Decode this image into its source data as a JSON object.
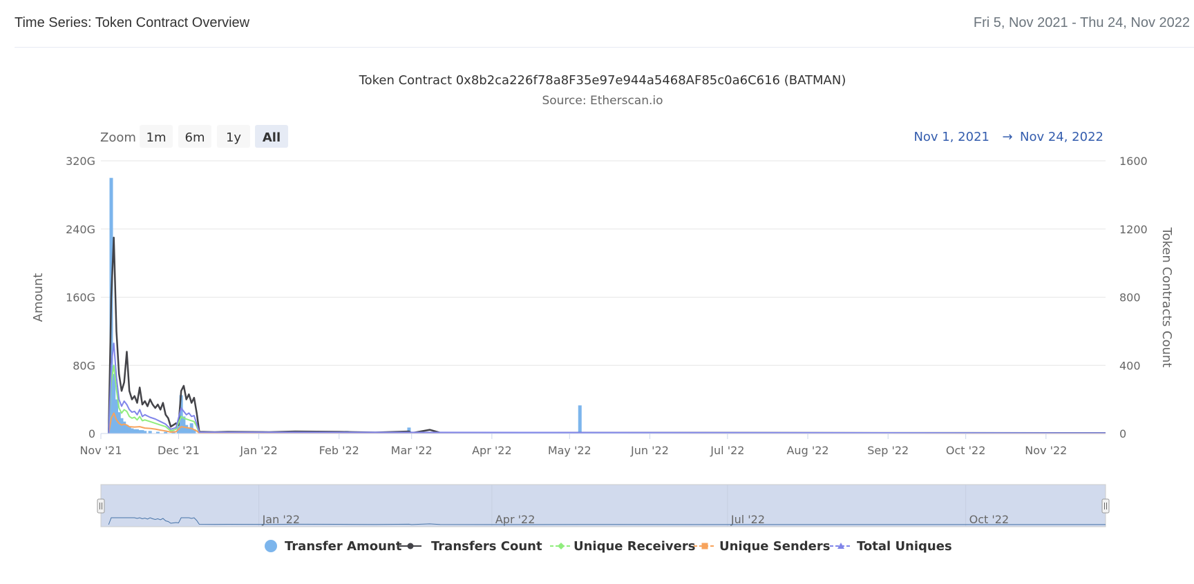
{
  "header": {
    "title": "Time Series: Token Contract Overview",
    "date_range": "Fri 5, Nov 2021 - Thu 24, Nov 2022"
  },
  "chart_data": {
    "type": "line",
    "title": "Token Contract 0x8b2ca226f78a8F35e97e944a5468AF85c0a6C616 (BATMAN)",
    "subtitle": "Source: Etherscan.io",
    "zoom": {
      "label": "Zoom",
      "buttons": [
        "1m",
        "6m",
        "1y",
        "All"
      ],
      "selected": "All"
    },
    "range_selector": {
      "from": "Nov 1, 2021",
      "arrow": "→",
      "to": "Nov 24, 2022"
    },
    "x_axis": {
      "range": [
        "2021-11-01",
        "2022-11-24"
      ],
      "tick_labels": [
        "Nov '21",
        "Dec '21",
        "Jan '22",
        "Feb '22",
        "Mar '22",
        "Apr '22",
        "May '22",
        "Jun '22",
        "Jul '22",
        "Aug '22",
        "Sep '22",
        "Oct '22",
        "Nov '22"
      ],
      "tick_dates": [
        "2021-11-01",
        "2021-12-01",
        "2022-01-01",
        "2022-02-01",
        "2022-03-01",
        "2022-04-01",
        "2022-05-01",
        "2022-06-01",
        "2022-07-01",
        "2022-08-01",
        "2022-09-01",
        "2022-10-01",
        "2022-11-01"
      ]
    },
    "y_axis_left": {
      "label": "Amount",
      "ylim": [
        0,
        320
      ],
      "unit": "G",
      "ticks": [
        "0",
        "80G",
        "160G",
        "240G",
        "320G"
      ]
    },
    "y_axis_right": {
      "label": "Token Contracts Count",
      "ylim": [
        0,
        1600
      ],
      "ticks": [
        "0",
        "400",
        "800",
        "1200",
        "1600"
      ]
    },
    "grid": true,
    "legend_position": "bottom-center",
    "series": [
      {
        "name": "Transfer Amount",
        "type": "column",
        "axis": "left",
        "color": "#7cb5ec",
        "points": [
          [
            "2021-11-05",
            300
          ],
          [
            "2021-11-06",
            70
          ],
          [
            "2021-11-07",
            40
          ],
          [
            "2021-11-08",
            25
          ],
          [
            "2021-11-09",
            18
          ],
          [
            "2021-11-10",
            14
          ],
          [
            "2021-11-11",
            10
          ],
          [
            "2021-11-12",
            8
          ],
          [
            "2021-11-13",
            6
          ],
          [
            "2021-11-14",
            5
          ],
          [
            "2021-11-15",
            5
          ],
          [
            "2021-11-16",
            4
          ],
          [
            "2021-11-17",
            4
          ],
          [
            "2021-11-18",
            3
          ],
          [
            "2021-11-20",
            3
          ],
          [
            "2021-11-23",
            2
          ],
          [
            "2021-11-26",
            2
          ],
          [
            "2021-11-29",
            3
          ],
          [
            "2021-12-01",
            12
          ],
          [
            "2021-12-02",
            45
          ],
          [
            "2021-12-03",
            20
          ],
          [
            "2021-12-04",
            10
          ],
          [
            "2021-12-05",
            6
          ],
          [
            "2021-12-06",
            12
          ],
          [
            "2021-12-07",
            5
          ],
          [
            "2022-02-04",
            3
          ],
          [
            "2022-02-28",
            7
          ],
          [
            "2022-05-05",
            33
          ]
        ]
      },
      {
        "name": "Transfers Count",
        "type": "line",
        "axis": "right",
        "color": "#434348",
        "points": [
          [
            "2021-11-04",
            0
          ],
          [
            "2021-11-05",
            800
          ],
          [
            "2021-11-06",
            1150
          ],
          [
            "2021-11-07",
            600
          ],
          [
            "2021-11-08",
            350
          ],
          [
            "2021-11-09",
            250
          ],
          [
            "2021-11-10",
            300
          ],
          [
            "2021-11-11",
            480
          ],
          [
            "2021-11-12",
            250
          ],
          [
            "2021-11-13",
            200
          ],
          [
            "2021-11-14",
            220
          ],
          [
            "2021-11-15",
            180
          ],
          [
            "2021-11-16",
            270
          ],
          [
            "2021-11-17",
            170
          ],
          [
            "2021-11-18",
            190
          ],
          [
            "2021-11-19",
            160
          ],
          [
            "2021-11-20",
            200
          ],
          [
            "2021-11-21",
            170
          ],
          [
            "2021-11-22",
            150
          ],
          [
            "2021-11-23",
            170
          ],
          [
            "2021-11-24",
            140
          ],
          [
            "2021-11-25",
            180
          ],
          [
            "2021-11-26",
            110
          ],
          [
            "2021-11-27",
            90
          ],
          [
            "2021-11-28",
            40
          ],
          [
            "2021-11-29",
            50
          ],
          [
            "2021-11-30",
            60
          ],
          [
            "2021-12-01",
            50
          ],
          [
            "2021-12-02",
            250
          ],
          [
            "2021-12-03",
            280
          ],
          [
            "2021-12-04",
            200
          ],
          [
            "2021-12-05",
            230
          ],
          [
            "2021-12-06",
            180
          ],
          [
            "2021-12-07",
            210
          ],
          [
            "2021-12-08",
            120
          ],
          [
            "2021-12-09",
            10
          ],
          [
            "2021-12-15",
            8
          ],
          [
            "2021-12-20",
            10
          ],
          [
            "2022-01-05",
            8
          ],
          [
            "2022-01-15",
            12
          ],
          [
            "2022-02-01",
            10
          ],
          [
            "2022-02-15",
            6
          ],
          [
            "2022-02-28",
            12
          ],
          [
            "2022-03-01",
            3
          ],
          [
            "2022-03-08",
            22
          ],
          [
            "2022-03-12",
            5
          ],
          [
            "2022-04-01",
            3
          ],
          [
            "2022-05-05",
            5
          ],
          [
            "2022-11-24",
            3
          ]
        ]
      },
      {
        "name": "Unique Receivers",
        "type": "line",
        "axis": "right",
        "color": "#90ed7d",
        "points": [
          [
            "2021-11-04",
            0
          ],
          [
            "2021-11-05",
            300
          ],
          [
            "2021-11-06",
            400
          ],
          [
            "2021-11-07",
            260
          ],
          [
            "2021-11-08",
            150
          ],
          [
            "2021-11-09",
            120
          ],
          [
            "2021-11-10",
            140
          ],
          [
            "2021-11-11",
            130
          ],
          [
            "2021-11-12",
            100
          ],
          [
            "2021-11-13",
            90
          ],
          [
            "2021-11-14",
            95
          ],
          [
            "2021-11-15",
            80
          ],
          [
            "2021-11-16",
            100
          ],
          [
            "2021-11-17",
            75
          ],
          [
            "2021-11-18",
            80
          ],
          [
            "2021-11-20",
            70
          ],
          [
            "2021-11-22",
            60
          ],
          [
            "2021-11-24",
            50
          ],
          [
            "2021-11-26",
            40
          ],
          [
            "2021-11-28",
            15
          ],
          [
            "2021-11-30",
            25
          ],
          [
            "2021-12-02",
            100
          ],
          [
            "2021-12-03",
            90
          ],
          [
            "2021-12-05",
            80
          ],
          [
            "2021-12-07",
            70
          ],
          [
            "2021-12-08",
            40
          ],
          [
            "2021-12-09",
            5
          ],
          [
            "2022-11-24",
            2
          ]
        ]
      },
      {
        "name": "Unique Senders",
        "type": "line",
        "axis": "right",
        "color": "#f7a35c",
        "points": [
          [
            "2021-11-04",
            0
          ],
          [
            "2021-11-05",
            90
          ],
          [
            "2021-11-06",
            120
          ],
          [
            "2021-11-07",
            80
          ],
          [
            "2021-11-08",
            60
          ],
          [
            "2021-11-09",
            50
          ],
          [
            "2021-11-10",
            55
          ],
          [
            "2021-11-11",
            50
          ],
          [
            "2021-11-12",
            40
          ],
          [
            "2021-11-14",
            38
          ],
          [
            "2021-11-16",
            40
          ],
          [
            "2021-11-18",
            32
          ],
          [
            "2021-11-20",
            30
          ],
          [
            "2021-11-22",
            26
          ],
          [
            "2021-11-24",
            20
          ],
          [
            "2021-11-26",
            15
          ],
          [
            "2021-11-28",
            8
          ],
          [
            "2021-11-30",
            10
          ],
          [
            "2021-12-02",
            40
          ],
          [
            "2021-12-04",
            35
          ],
          [
            "2021-12-06",
            30
          ],
          [
            "2021-12-08",
            15
          ],
          [
            "2021-12-09",
            3
          ],
          [
            "2022-11-24",
            1
          ]
        ]
      },
      {
        "name": "Total Uniques",
        "type": "line",
        "axis": "right",
        "color": "#8085e9",
        "points": [
          [
            "2021-11-04",
            0
          ],
          [
            "2021-11-05",
            400
          ],
          [
            "2021-11-06",
            530
          ],
          [
            "2021-11-07",
            330
          ],
          [
            "2021-11-08",
            200
          ],
          [
            "2021-11-09",
            160
          ],
          [
            "2021-11-10",
            190
          ],
          [
            "2021-11-11",
            170
          ],
          [
            "2021-11-12",
            140
          ],
          [
            "2021-11-13",
            125
          ],
          [
            "2021-11-14",
            130
          ],
          [
            "2021-11-15",
            110
          ],
          [
            "2021-11-16",
            140
          ],
          [
            "2021-11-17",
            100
          ],
          [
            "2021-11-18",
            110
          ],
          [
            "2021-11-20",
            95
          ],
          [
            "2021-11-22",
            85
          ],
          [
            "2021-11-24",
            70
          ],
          [
            "2021-11-26",
            55
          ],
          [
            "2021-11-28",
            25
          ],
          [
            "2021-11-30",
            35
          ],
          [
            "2021-12-02",
            150
          ],
          [
            "2021-12-03",
            130
          ],
          [
            "2021-12-04",
            110
          ],
          [
            "2021-12-05",
            120
          ],
          [
            "2021-12-06",
            100
          ],
          [
            "2021-12-07",
            105
          ],
          [
            "2021-12-08",
            55
          ],
          [
            "2021-12-09",
            8
          ],
          [
            "2022-11-24",
            3
          ]
        ]
      }
    ],
    "navigator": {
      "tick_labels": [
        "Jan '22",
        "Apr '22",
        "Jul '22",
        "Oct '22"
      ],
      "tick_dates": [
        "2022-01-01",
        "2022-04-01",
        "2022-07-01",
        "2022-10-01"
      ]
    }
  }
}
